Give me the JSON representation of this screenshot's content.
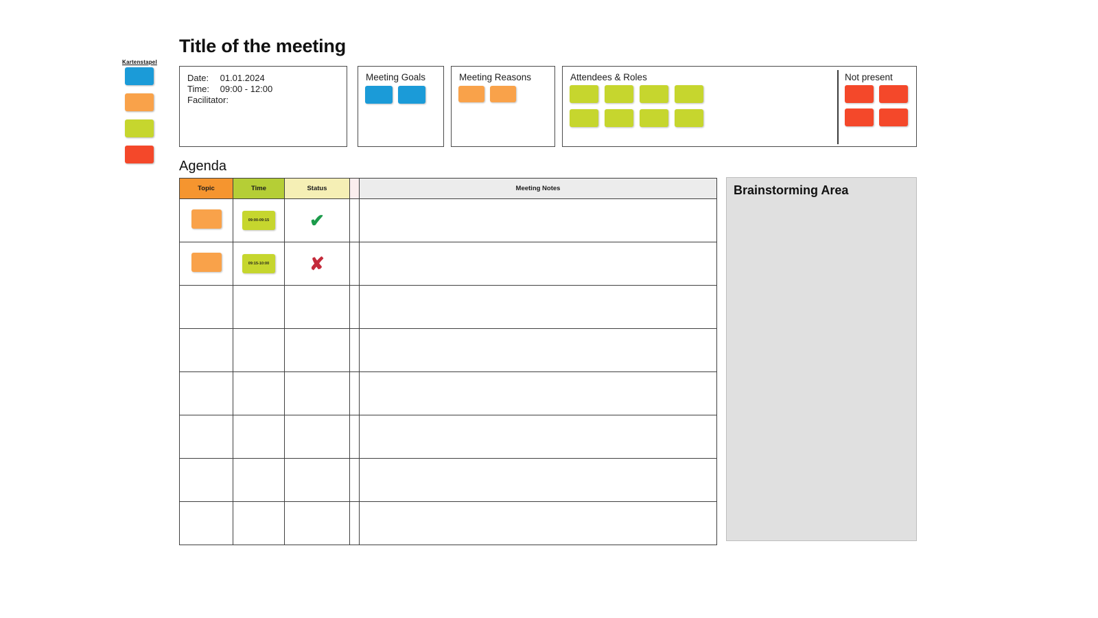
{
  "card_stack": {
    "label": "Kartenstapel",
    "cards": [
      {
        "name": "blue-card",
        "color": "#1B9BD8"
      },
      {
        "name": "orange-card",
        "color": "#F9A24A"
      },
      {
        "name": "green-card",
        "color": "#C6D62E"
      },
      {
        "name": "red-card",
        "color": "#F4482A"
      }
    ]
  },
  "title": "Title of the meeting",
  "meeting_info": {
    "rows": [
      {
        "key": "Date:",
        "value": "01.01.2024"
      },
      {
        "key": "Time:",
        "value": "09:00 - 12:00"
      },
      {
        "key": "Facilitator:",
        "value": ""
      }
    ]
  },
  "meeting_goals": {
    "label": "Meeting Goals",
    "cards": [
      {
        "name": "goal-card-1",
        "color": "#1B9BD8"
      },
      {
        "name": "goal-card-2",
        "color": "#1B9BD8"
      }
    ]
  },
  "meeting_reasons": {
    "label": "Meeting Reasons",
    "cards": [
      {
        "name": "reason-card-1",
        "color": "#F9A24A"
      },
      {
        "name": "reason-card-2",
        "color": "#F9A24A"
      }
    ]
  },
  "attendees": {
    "label": "Attendees & Roles",
    "cards": [
      {
        "name": "attendee-card-1",
        "color": "#C6D62E"
      },
      {
        "name": "attendee-card-2",
        "color": "#C6D62E"
      },
      {
        "name": "attendee-card-3",
        "color": "#C6D62E"
      },
      {
        "name": "attendee-card-4",
        "color": "#C6D62E"
      },
      {
        "name": "attendee-card-5",
        "color": "#C6D62E"
      },
      {
        "name": "attendee-card-6",
        "color": "#C6D62E"
      },
      {
        "name": "attendee-card-7",
        "color": "#C6D62E"
      },
      {
        "name": "attendee-card-8",
        "color": "#C6D62E"
      }
    ]
  },
  "not_present": {
    "label": "Not present",
    "cards": [
      {
        "name": "absent-card-1",
        "color": "#F4482A"
      },
      {
        "name": "absent-card-2",
        "color": "#F4482A"
      },
      {
        "name": "absent-card-3",
        "color": "#F4482A"
      },
      {
        "name": "absent-card-4",
        "color": "#F4482A"
      }
    ]
  },
  "agenda": {
    "heading": "Agenda",
    "columns": [
      {
        "name": "topic",
        "label": "Topic",
        "color": "#F5952F"
      },
      {
        "name": "time",
        "label": "Time",
        "color": "#B5CE36"
      },
      {
        "name": "status",
        "label": "Status",
        "color": "#F5EFB5"
      },
      {
        "name": "gap",
        "label": "",
        "color": "#FBEEEE"
      },
      {
        "name": "notes",
        "label": "Meeting Notes",
        "color": "#ECECEC"
      }
    ],
    "rows": [
      {
        "topic_card": "#F9A24A",
        "time": "09:00-09:15",
        "time_card": "#C6D62E",
        "status": "check",
        "status_glyph": "✔",
        "notes": ""
      },
      {
        "topic_card": "#F9A24A",
        "time": "09:15-10:00",
        "time_card": "#C6D62E",
        "status": "cross",
        "status_glyph": "✘",
        "notes": ""
      },
      {
        "topic_card": "",
        "time": "",
        "time_card": "",
        "status": "",
        "status_glyph": "",
        "notes": ""
      },
      {
        "topic_card": "",
        "time": "",
        "time_card": "",
        "status": "",
        "status_glyph": "",
        "notes": ""
      },
      {
        "topic_card": "",
        "time": "",
        "time_card": "",
        "status": "",
        "status_glyph": "",
        "notes": ""
      },
      {
        "topic_card": "",
        "time": "",
        "time_card": "",
        "status": "",
        "status_glyph": "",
        "notes": ""
      },
      {
        "topic_card": "",
        "time": "",
        "time_card": "",
        "status": "",
        "status_glyph": "",
        "notes": ""
      },
      {
        "topic_card": "",
        "time": "",
        "time_card": "",
        "status": "",
        "status_glyph": "",
        "notes": ""
      }
    ]
  },
  "brainstorming": {
    "title": "Brainstorming Area",
    "background": "#E0E0E0"
  },
  "colors": {
    "blue": "#1B9BD8",
    "orange": "#F9A24A",
    "green": "#C6D62E",
    "red": "#F4482A",
    "check_green": "#1C9B4B",
    "cross_red": "#C42A3A"
  }
}
